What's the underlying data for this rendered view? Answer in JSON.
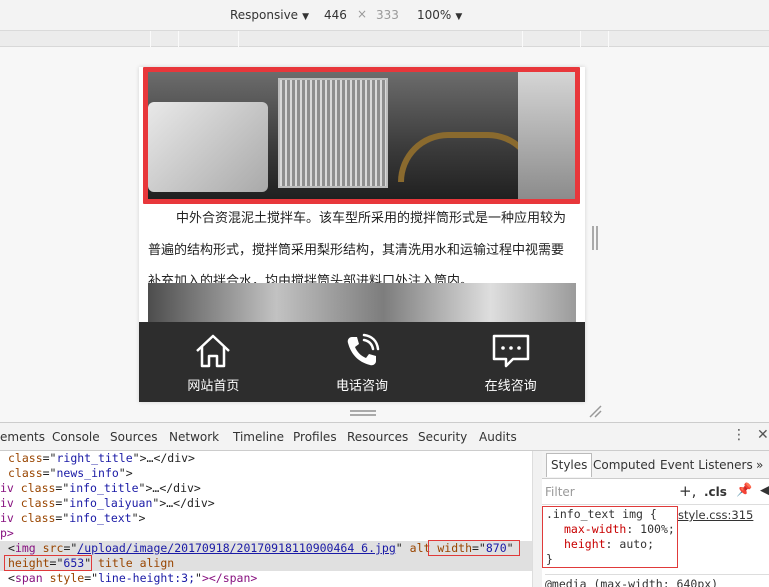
{
  "device_toolbar": {
    "mode": "Responsive",
    "width": "446",
    "height": "333",
    "zoom": "100%"
  },
  "page": {
    "article_text": "中外合资混泥土搅拌车。该车型所采用的搅拌筒形式是一种应用较为普遍的结构形式，搅拌筒采用梨形结构，其清洗用水和运输过程中视需要补充加入的拌合水，均由搅拌筒头部进料口处注入筒内。",
    "nav": [
      {
        "label": "网站首页",
        "icon": "home-icon"
      },
      {
        "label": "电话咨询",
        "icon": "phone-icon"
      },
      {
        "label": "在线咨询",
        "icon": "chat-icon"
      }
    ],
    "colors": {
      "nav_bg": "#2d2d2d",
      "hero_border": "#e8373b"
    }
  },
  "devtools": {
    "tabs": [
      "ements",
      "Console",
      "Sources",
      "Network",
      "Timeline",
      "Profiles",
      "Resources",
      "Security",
      "Audits"
    ],
    "elements": {
      "line1": {
        "attr": "class",
        "val": "right_title",
        "rest": "…</div>"
      },
      "line2": {
        "attr": "class",
        "val": "news_info",
        "rest": ">"
      },
      "line3": {
        "prefix": "iv",
        "attr": "class",
        "val": "info_title",
        "rest": ">…</div>"
      },
      "line4": {
        "prefix": "iv",
        "attr": "class",
        "val": "info_laiyuan",
        "rest": ">…</div>"
      },
      "line5": {
        "prefix": "iv",
        "attr": "class",
        "val": "info_text",
        "rest": ">"
      },
      "line6": {
        "text": "p>"
      },
      "img": {
        "tag": "img",
        "src_attr": "src",
        "src": "/upload/image/20170918/20170918110900464 6.jpg",
        "alt": "alt",
        "width_attr": "width",
        "width_val": "870",
        "height_attr": "height",
        "height_val": "653",
        "rest": "title align"
      },
      "span": {
        "tag": "span",
        "attr": "style",
        "val": "line-height:3;",
        "rest": "></span>"
      }
    },
    "styles": {
      "tabs": [
        "Styles",
        "Computed",
        "Event Listeners"
      ],
      "filter_placeholder": "Filter",
      "cls": ".cls",
      "rule_selector": ".info_text img {",
      "rule_prop1": "max-width",
      "rule_val1": "100%;",
      "rule_prop2": "height",
      "rule_val2": "auto;",
      "rule_close": "}",
      "rule_source": "style.css:315",
      "media": "@media (max-width: 640px)"
    }
  }
}
